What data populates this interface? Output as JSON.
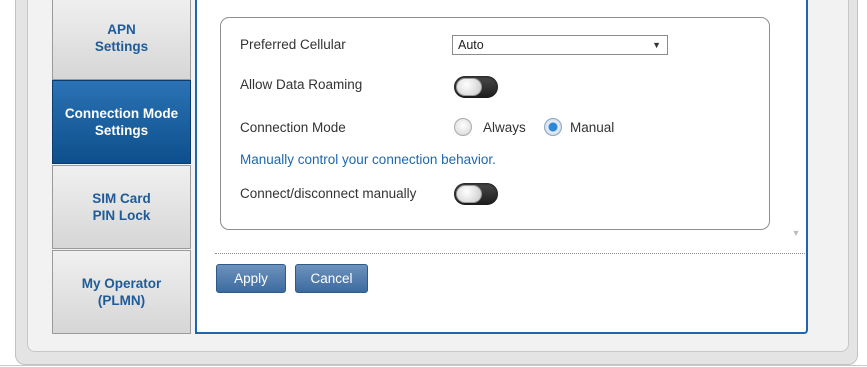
{
  "sidebar": {
    "items": [
      {
        "label": "APN\nSettings",
        "active": false
      },
      {
        "label": "Connection Mode\nSettings",
        "active": true
      },
      {
        "label": "SIM Card\nPIN Lock",
        "active": false
      },
      {
        "label": "My Operator\n(PLMN)",
        "active": false
      }
    ]
  },
  "form": {
    "preferred_cellular": {
      "label": "Preferred Cellular",
      "value": "Auto"
    },
    "data_roaming": {
      "label": "Allow Data Roaming",
      "state": "off"
    },
    "connection_mode": {
      "label": "Connection Mode",
      "options": [
        "Always",
        "Manual"
      ],
      "selected": "Manual"
    },
    "help_text": "Manually control your connection behavior.",
    "connect_manual": {
      "label": "Connect/disconnect manually",
      "state": "off"
    }
  },
  "buttons": {
    "apply": "Apply",
    "cancel": "Cancel"
  },
  "colors": {
    "accent": "#1f67ad",
    "active_tab": "#0d4f8c"
  }
}
